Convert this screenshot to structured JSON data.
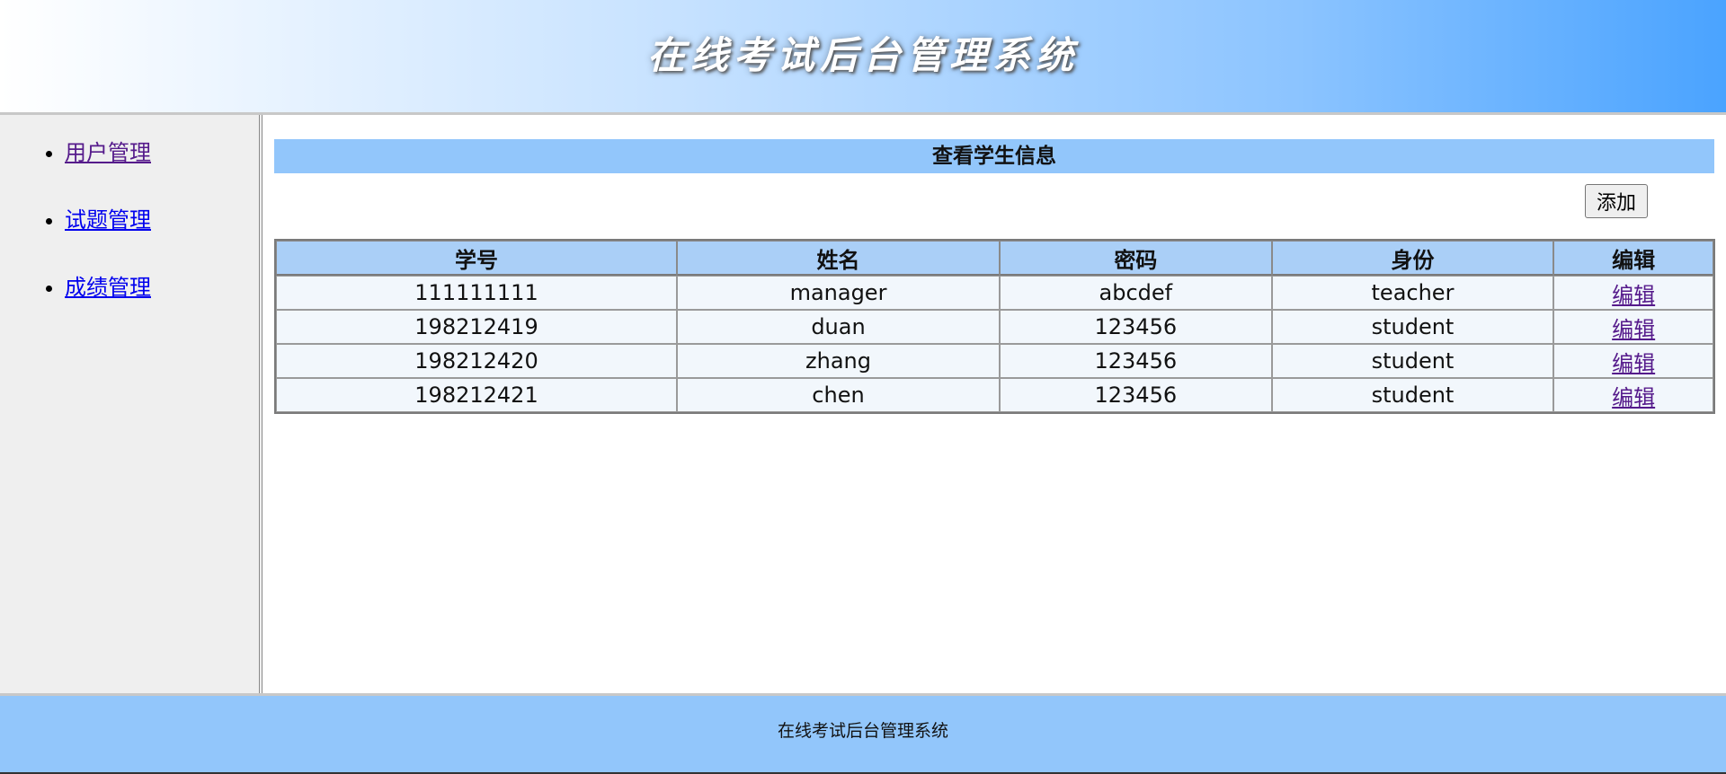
{
  "header": {
    "title": "在线考试后台管理系统"
  },
  "sidebar": {
    "items": [
      {
        "label": "用户管理",
        "state": "visited"
      },
      {
        "label": "试题管理",
        "state": "unvisited"
      },
      {
        "label": "成绩管理",
        "state": "unvisited"
      }
    ]
  },
  "main": {
    "section_title": "查看学生信息",
    "add_label": "添加",
    "table": {
      "columns": [
        "学号",
        "姓名",
        "密码",
        "身份",
        "编辑"
      ],
      "rows": [
        {
          "id": "111111111",
          "name": "manager",
          "password": "abcdef",
          "role": "teacher",
          "edit": "编辑"
        },
        {
          "id": "198212419",
          "name": "duan",
          "password": "123456",
          "role": "student",
          "edit": "编辑"
        },
        {
          "id": "198212420",
          "name": "zhang",
          "password": "123456",
          "role": "student",
          "edit": "编辑"
        },
        {
          "id": "198212421",
          "name": "chen",
          "password": "123456",
          "role": "student",
          "edit": "编辑"
        }
      ]
    }
  },
  "footer": {
    "text": "在线考试后台管理系统"
  },
  "colors": {
    "header_gradient_end": "#4aa3ff",
    "section_title_bg": "#92c6fb",
    "table_header_bg": "#aacff7",
    "footer_bg": "#92c6fb",
    "visited_link": "#551a8b",
    "unvisited_link": "#0000ee"
  }
}
